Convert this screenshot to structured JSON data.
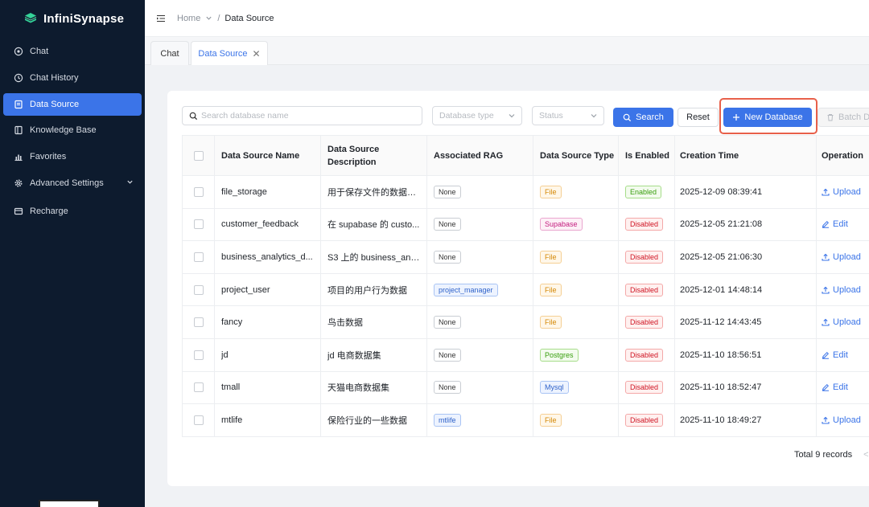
{
  "app": {
    "brand": "InfiniSynapse",
    "brand_color": "#34d399",
    "accent_color": "#3b74e8"
  },
  "sidebar": {
    "items": [
      {
        "label": "Chat",
        "icon": "chat-icon"
      },
      {
        "label": "Chat History",
        "icon": "history-icon"
      },
      {
        "label": "Data Source",
        "icon": "database-icon",
        "active": true
      },
      {
        "label": "Knowledge Base",
        "icon": "book-icon"
      },
      {
        "label": "Favorites",
        "icon": "chart-icon"
      },
      {
        "label": "Advanced Settings",
        "icon": "gear-icon"
      },
      {
        "label": "Recharge",
        "icon": "card-icon"
      }
    ]
  },
  "breadcrumb": {
    "home": "Home",
    "separator": "/",
    "current": "Data Source"
  },
  "tabs": [
    {
      "label": "Chat"
    },
    {
      "label": "Data Source",
      "active": true
    }
  ],
  "toolbar": {
    "search_placeholder": "Search database name",
    "type_placeholder": "Database type",
    "status_placeholder": "Status",
    "search_label": "Search",
    "reset_label": "Reset",
    "new_label": "New Database",
    "batch_label": "Batch D"
  },
  "table": {
    "headers": {
      "name": "Data Source Name",
      "desc": "Data Source Description",
      "rag": "Associated RAG",
      "type": "Data Source Type",
      "enabled": "Is Enabled",
      "time": "Creation Time",
      "op": "Operation"
    },
    "rows": [
      {
        "name": "file_storage",
        "desc": "用于保存文件的数据源。",
        "rag": "None",
        "type": "File",
        "enabled": "Enabled",
        "time": "2025-12-09 08:39:41",
        "op": "Upload"
      },
      {
        "name": "customer_feedback",
        "desc": "在 supabase 的 custo...",
        "rag": "None",
        "type": "Supabase",
        "enabled": "Disabled",
        "time": "2025-12-05 21:21:08",
        "op": "Edit"
      },
      {
        "name": "business_analytics_d...",
        "desc": "S3 上的 business_anal...",
        "rag": "None",
        "type": "File",
        "enabled": "Disabled",
        "time": "2025-12-05 21:06:30",
        "op": "Upload"
      },
      {
        "name": "project_user",
        "desc": "项目的用户行为数据",
        "rag": "project_manager",
        "type": "File",
        "enabled": "Disabled",
        "time": "2025-12-01 14:48:14",
        "op": "Upload"
      },
      {
        "name": "fancy",
        "desc": "鸟击数据",
        "rag": "None",
        "type": "File",
        "enabled": "Disabled",
        "time": "2025-11-12 14:43:45",
        "op": "Upload"
      },
      {
        "name": "jd",
        "desc": "jd 电商数据集",
        "rag": "None",
        "type": "Postgres",
        "enabled": "Disabled",
        "time": "2025-11-10 18:56:51",
        "op": "Edit"
      },
      {
        "name": "tmall",
        "desc": "天猫电商数据集",
        "rag": "None",
        "type": "Mysql",
        "enabled": "Disabled",
        "time": "2025-11-10 18:52:47",
        "op": "Edit"
      },
      {
        "name": "mtlife",
        "desc": "保险行业的一些数据",
        "rag": "mtlife",
        "type": "File",
        "enabled": "Disabled",
        "time": "2025-11-10 18:49:27",
        "op": "Upload"
      }
    ]
  },
  "pagination": {
    "total_text": "Total 9 records",
    "prev": "<"
  }
}
